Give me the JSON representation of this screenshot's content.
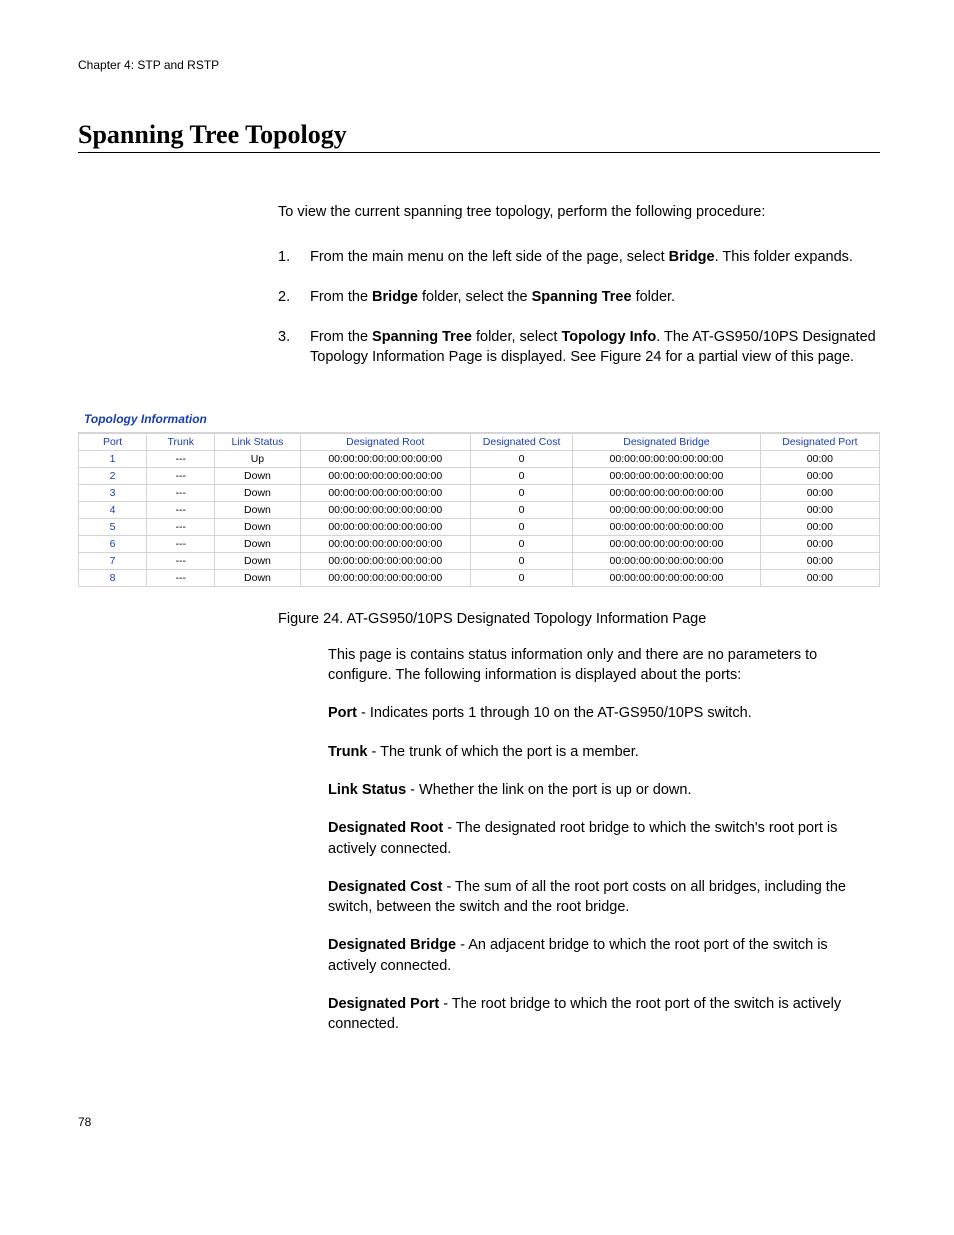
{
  "chapter_header": "Chapter 4: STP and RSTP",
  "section_title": "Spanning Tree Topology",
  "intro": "To view the current spanning tree topology, perform the following procedure:",
  "steps": [
    {
      "num": "1.",
      "pre": "From the main menu on the left side of the page, select ",
      "b1": "Bridge",
      "post": ". This folder expands."
    },
    {
      "num": "2.",
      "pre": "From the ",
      "b1": "Bridge",
      "mid": " folder, select the ",
      "b2": "Spanning Tree",
      "post": " folder."
    },
    {
      "num": "3.",
      "pre": "From the ",
      "b1": "Spanning Tree",
      "mid": " folder, select ",
      "b2": "Topology Info",
      "post": ". The AT-GS950/10PS Designated Topology Information Page is displayed. See Figure 24 for a partial view of this page."
    }
  ],
  "figure": {
    "title": "Topology Information",
    "headers": [
      "Port",
      "Trunk",
      "Link Status",
      "Designated Root",
      "Designated Cost",
      "Designated Bridge",
      "Designated Port"
    ],
    "rows": [
      [
        "1",
        "---",
        "Up",
        "00:00:00:00:00:00:00:00",
        "0",
        "00:00:00:00:00:00:00:00",
        "00:00"
      ],
      [
        "2",
        "---",
        "Down",
        "00:00:00:00:00:00:00:00",
        "0",
        "00:00:00:00:00:00:00:00",
        "00:00"
      ],
      [
        "3",
        "---",
        "Down",
        "00:00:00:00:00:00:00:00",
        "0",
        "00:00:00:00:00:00:00:00",
        "00:00"
      ],
      [
        "4",
        "---",
        "Down",
        "00:00:00:00:00:00:00:00",
        "0",
        "00:00:00:00:00:00:00:00",
        "00:00"
      ],
      [
        "5",
        "---",
        "Down",
        "00:00:00:00:00:00:00:00",
        "0",
        "00:00:00:00:00:00:00:00",
        "00:00"
      ],
      [
        "6",
        "---",
        "Down",
        "00:00:00:00:00:00:00:00",
        "0",
        "00:00:00:00:00:00:00:00",
        "00:00"
      ],
      [
        "7",
        "---",
        "Down",
        "00:00:00:00:00:00:00:00",
        "0",
        "00:00:00:00:00:00:00:00",
        "00:00"
      ],
      [
        "8",
        "---",
        "Down",
        "00:00:00:00:00:00:00:00",
        "0",
        "00:00:00:00:00:00:00:00",
        "00:00"
      ]
    ],
    "caption": "Figure 24. AT-GS950/10PS Designated Topology Information Page"
  },
  "desc_intro": "This page is contains status information only and there are no parameters to configure. The following information is displayed about the ports:",
  "defs": [
    {
      "term": "Port",
      "text": " - Indicates ports 1 through 10 on the AT-GS950/10PS switch."
    },
    {
      "term": "Trunk",
      "text": " - The trunk of which the port is a member."
    },
    {
      "term": "Link Status",
      "text": " - Whether the link on the port is up or down."
    },
    {
      "term": "Designated Root",
      "text": " - The designated root bridge to which the switch's root port is actively connected."
    },
    {
      "term": "Designated Cost",
      "text": " - The sum of all the root port costs on all bridges, including the switch, between the switch and the root bridge."
    },
    {
      "term": "Designated Bridge",
      "text": " - An adjacent bridge to which the root port of the switch is actively connected."
    },
    {
      "term": "Designated Port",
      "text": " - The root bridge to which the root port of the switch is actively connected."
    }
  ],
  "page_number": "78"
}
